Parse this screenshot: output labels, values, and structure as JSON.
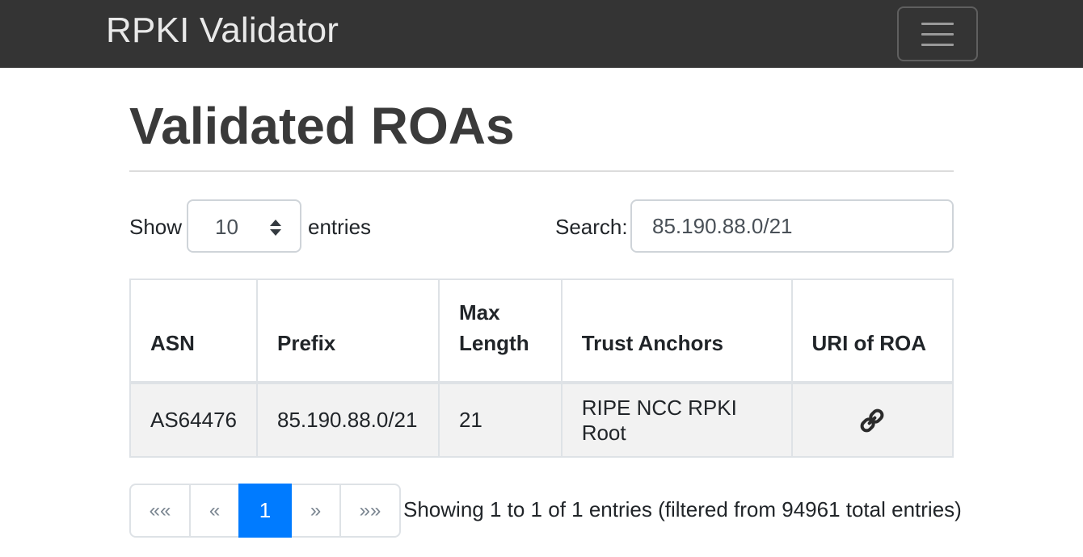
{
  "navbar": {
    "brand": "RPKI Validator",
    "toggler_icon": "hamburger-menu-icon"
  },
  "page": {
    "title": "Validated ROAs"
  },
  "length_control": {
    "show_label": "Show",
    "selected": "10",
    "entries_label": "entries",
    "icon": "sort-arrows-icon"
  },
  "search": {
    "label": "Search:",
    "value": "85.190.88.0/21"
  },
  "table": {
    "headers": {
      "asn": "ASN",
      "prefix": "Prefix",
      "max_length_line1": "Max",
      "max_length_line2": "Length",
      "trust_anchors": "Trust Anchors",
      "uri": "URI of ROA"
    },
    "rows": [
      {
        "asn": "AS64476",
        "prefix": "85.190.88.0/21",
        "max_length": "21",
        "trust_anchor": "RIPE NCC RPKI Root",
        "uri_icon": "link-icon"
      }
    ]
  },
  "pagination": {
    "first": "««",
    "prev": "«",
    "current": "1",
    "next": "»",
    "last": "»»"
  },
  "info": "Showing 1 to 1 of 1 entries (filtered from 94961 total entries)",
  "colors": {
    "navbar_bg": "#343434",
    "accent": "#007bff",
    "row_bg": "#f2f2f2"
  }
}
